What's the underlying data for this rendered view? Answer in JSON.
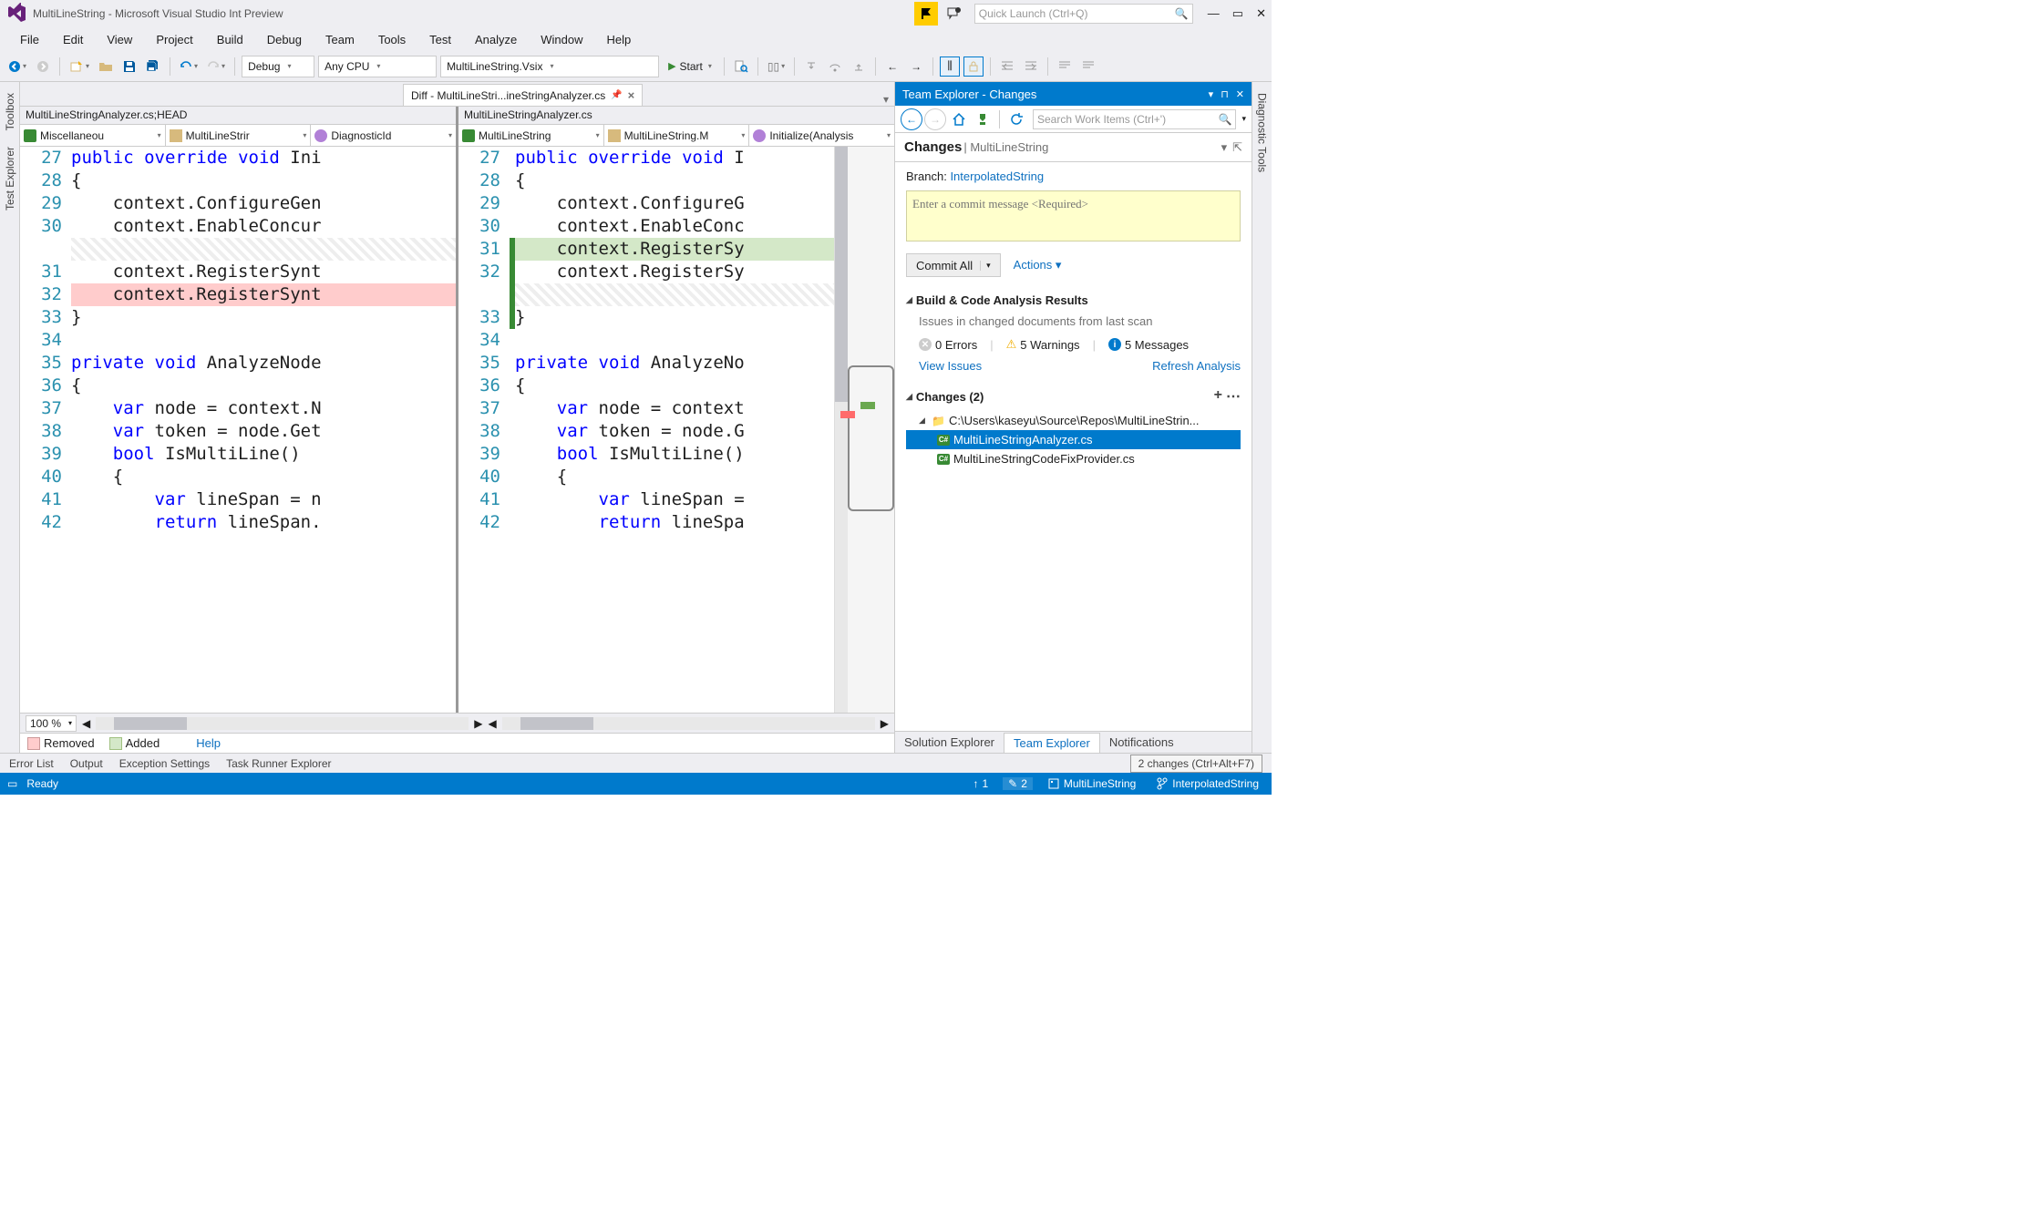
{
  "titlebar": {
    "title": "MultiLineString - Microsoft Visual Studio Int Preview",
    "quickLaunchPlaceholder": "Quick Launch (Ctrl+Q)"
  },
  "menu": {
    "file": "File",
    "edit": "Edit",
    "view": "View",
    "project": "Project",
    "build": "Build",
    "debug": "Debug",
    "team": "Team",
    "tools": "Tools",
    "test": "Test",
    "analyze": "Analyze",
    "window": "Window",
    "help": "Help"
  },
  "toolbar": {
    "config": "Debug",
    "platform": "Any CPU",
    "startup": "MultiLineString.Vsix",
    "start": "Start"
  },
  "docTab": {
    "title": "Diff - MultiLineStri...ineStringAnalyzer.cs"
  },
  "leftPane": {
    "header": "MultiLineStringAnalyzer.cs;HEAD",
    "nav1": "Miscellaneou",
    "nav2": "MultiLineStrir",
    "nav3": "DiagnosticId",
    "lines": [
      {
        "n": "27",
        "t": "public override void Ini",
        "kw": [
          "public",
          "override",
          "void"
        ]
      },
      {
        "n": "28",
        "t": "{"
      },
      {
        "n": "29",
        "t": "    context.ConfigureGen"
      },
      {
        "n": "30",
        "t": "    context.EnableConcur"
      },
      {
        "n": "",
        "t": "",
        "cls": "line-hatch"
      },
      {
        "n": "31",
        "t": "    context.RegisterSynt"
      },
      {
        "n": "32",
        "t": "    context.RegisterSynt",
        "cls": "line-removed"
      },
      {
        "n": "33",
        "t": "}"
      },
      {
        "n": "34",
        "t": ""
      },
      {
        "n": "35",
        "t": "private void AnalyzeNode",
        "kw": [
          "private",
          "void"
        ]
      },
      {
        "n": "36",
        "t": "{"
      },
      {
        "n": "37",
        "t": "    var node = context.N",
        "kw": [
          "var"
        ]
      },
      {
        "n": "38",
        "t": "    var token = node.Get",
        "kw": [
          "var"
        ]
      },
      {
        "n": "39",
        "t": "    bool IsMultiLine()",
        "kw": [
          "bool"
        ]
      },
      {
        "n": "40",
        "t": "    {"
      },
      {
        "n": "41",
        "t": "        var lineSpan = n",
        "kw": [
          "var"
        ]
      },
      {
        "n": "42",
        "t": "        return lineSpan.",
        "kw": [
          "return"
        ]
      }
    ]
  },
  "rightPane": {
    "header": "MultiLineStringAnalyzer.cs",
    "nav1": "MultiLineString",
    "nav2": "MultiLineString.M",
    "nav3": "Initialize(Analysis",
    "lines": [
      {
        "n": "27",
        "t": "public override void I",
        "kw": [
          "public",
          "override",
          "void"
        ]
      },
      {
        "n": "28",
        "t": "{"
      },
      {
        "n": "29",
        "t": "    context.ConfigureG"
      },
      {
        "n": "30",
        "t": "    context.EnableConc"
      },
      {
        "n": "31",
        "t": "    context.RegisterSy",
        "cls": "line-added",
        "bar": true
      },
      {
        "n": "32",
        "t": "    context.RegisterSy",
        "bar": true
      },
      {
        "n": "",
        "t": "",
        "cls": "line-hatch",
        "bar": true
      },
      {
        "n": "33",
        "t": "}",
        "bar": true
      },
      {
        "n": "34",
        "t": ""
      },
      {
        "n": "35",
        "t": "private void AnalyzeNo",
        "kw": [
          "private",
          "void"
        ]
      },
      {
        "n": "36",
        "t": "{"
      },
      {
        "n": "37",
        "t": "    var node = context",
        "kw": [
          "var"
        ]
      },
      {
        "n": "38",
        "t": "    var token = node.G",
        "kw": [
          "var"
        ]
      },
      {
        "n": "39",
        "t": "    bool IsMultiLine()",
        "kw": [
          "bool"
        ]
      },
      {
        "n": "40",
        "t": "    {"
      },
      {
        "n": "41",
        "t": "        var lineSpan =",
        "kw": [
          "var"
        ]
      },
      {
        "n": "42",
        "t": "        return lineSpa",
        "kw": [
          "return"
        ]
      }
    ]
  },
  "diffFooter": {
    "zoom": "100 %"
  },
  "legend": {
    "removed": "Removed",
    "added": "Added",
    "help": "Help"
  },
  "teamExplorer": {
    "title": "Team Explorer - Changes",
    "searchPlaceholder": "Search Work Items (Ctrl+')",
    "pageTitle": "Changes",
    "pageSub": " | MultiLineString",
    "branchLabel": "Branch:",
    "branchName": "InterpolatedString",
    "commitPlaceholder": "Enter a commit message <Required>",
    "commitBtn": "Commit All",
    "actions": "Actions",
    "buildSection": "Build & Code Analysis Results",
    "issuesText": "Issues in changed documents from last scan",
    "errors": "0 Errors",
    "warnings": "5 Warnings",
    "messages": "5 Messages",
    "viewIssues": "View Issues",
    "refresh": "Refresh Analysis",
    "changesSection": "Changes (2)",
    "folderPath": "C:\\Users\\kaseyu\\Source\\Repos\\MultiLineStrin...",
    "file1": "MultiLineStringAnalyzer.cs",
    "file2": "MultiLineStringCodeFixProvider.cs",
    "bottomTabs": {
      "solution": "Solution Explorer",
      "team": "Team Explorer",
      "notif": "Notifications"
    }
  },
  "sideTabs": {
    "toolbox": "Toolbox",
    "testExplorer": "Test Explorer",
    "diag": "Diagnostic Tools"
  },
  "toolTabs": {
    "errorList": "Error List",
    "output": "Output",
    "exception": "Exception Settings",
    "taskRunner": "Task Runner Explorer",
    "tooltip": "2 changes (Ctrl+Alt+F7)"
  },
  "statusbar": {
    "ready": "Ready",
    "up": "1",
    "pending": "2",
    "repo": "MultiLineString",
    "branch": "InterpolatedString"
  }
}
